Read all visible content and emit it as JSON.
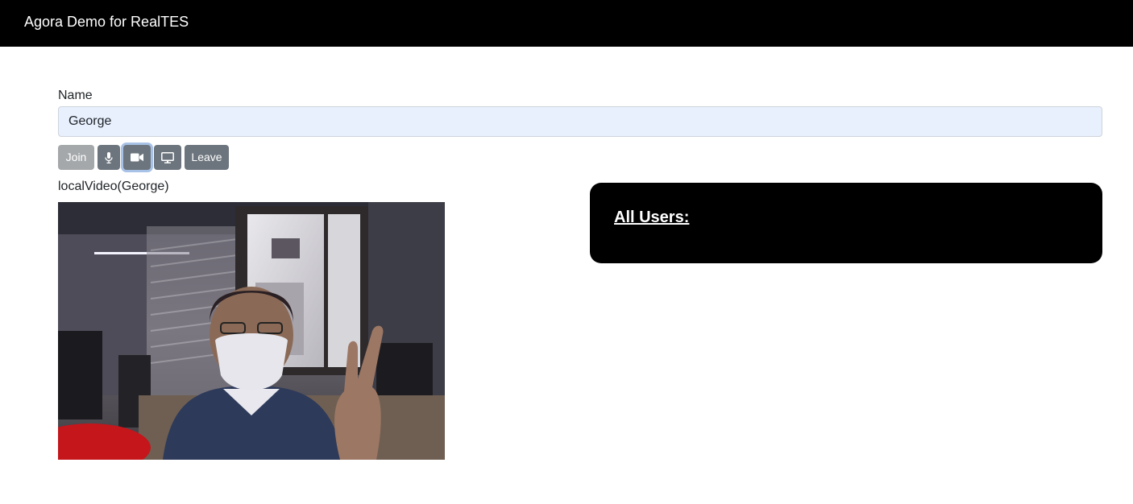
{
  "navbar": {
    "brand": "Agora Demo for RealTES"
  },
  "form": {
    "name_label": "Name",
    "name_value": "George"
  },
  "controls": {
    "join_label": "Join",
    "leave_label": "Leave",
    "mic_icon": "microphone-icon",
    "camera_icon": "video-camera-icon",
    "screen_icon": "desktop-screen-share-icon"
  },
  "local_video": {
    "label": "localVideo(George)"
  },
  "users_panel": {
    "title": "All Users:"
  },
  "colors": {
    "navbar_bg": "#000000",
    "button_bg": "#6c757d",
    "button_disabled_bg": "#a5a8ab",
    "input_bg": "#e8f0fe",
    "panel_bg": "#000000"
  }
}
